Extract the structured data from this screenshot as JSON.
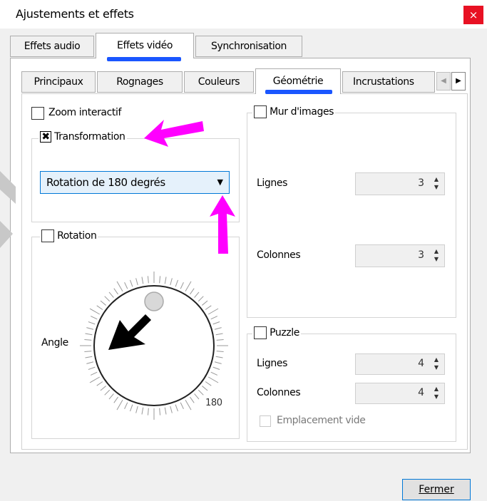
{
  "window": {
    "title": "Ajustements et effets",
    "close_glyph": "×"
  },
  "main_tabs": [
    {
      "label": "Effets audio"
    },
    {
      "label": "Effets vidéo"
    },
    {
      "label": "Synchronisation"
    }
  ],
  "sub_tabs": [
    {
      "label": "Principaux"
    },
    {
      "label": "Rognages"
    },
    {
      "label": "Couleurs"
    },
    {
      "label": "Géométrie"
    },
    {
      "label": "Incrustations"
    }
  ],
  "scroll_glyphs": {
    "left": "◀",
    "right": "▶"
  },
  "geometry": {
    "zoom_label": "Zoom interactif",
    "transform": {
      "label": "Transformation",
      "checkbox_glyph": "✖",
      "selected": "Rotation de 180 degrés",
      "combo_arrow": "▼"
    },
    "rotation": {
      "label": "Rotation",
      "angle_label": "Angle",
      "angle_value": "180"
    },
    "wall": {
      "label": "Mur d'images",
      "rows_label": "Lignes",
      "rows_value": "3",
      "cols_label": "Colonnes",
      "cols_value": "3"
    },
    "puzzle": {
      "label": "Puzzle",
      "rows_label": "Lignes",
      "rows_value": "4",
      "cols_label": "Colonnes",
      "cols_value": "4",
      "blank_label": "Emplacement vide"
    }
  },
  "spin_glyphs": {
    "up": "▲",
    "down": "▼"
  },
  "footer": {
    "close_label": "Fermer"
  },
  "colors": {
    "annotation_arrows": "#ff00ff",
    "tab_underline": "#1a56ff",
    "close_button": "#e81123"
  }
}
